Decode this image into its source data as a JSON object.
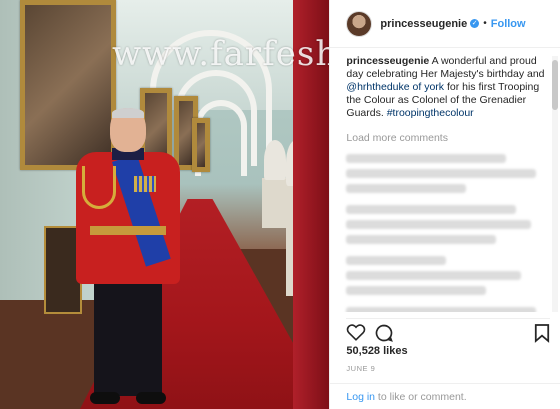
{
  "post_image": {
    "watermark": "www.farfesh.com"
  },
  "header": {
    "username": "princesseugenie",
    "separator": "•",
    "follow_label": "Follow"
  },
  "caption": {
    "username": "princesseugenie",
    "text_before_mention": " A wonderful and proud day celebrating Her Majesty's birthday and ",
    "mention": "@hrhtheduke of york",
    "text_after_mention": " for his first Trooping the Colour as Colonel of the Grenadier Guards. ",
    "hashtag": "#troopingthecolour"
  },
  "comments": {
    "load_more_label": "Load more comments"
  },
  "stats": {
    "likes": "50,528 likes",
    "date": "JUNE 9"
  },
  "login": {
    "link_label": "Log in",
    "suffix": " to like or comment."
  },
  "icons": {
    "like": "heart-icon",
    "comment": "comment-icon",
    "save": "bookmark-icon",
    "verified": "verified-badge-icon"
  },
  "colors": {
    "accent": "#3897f0",
    "link": "#003569",
    "muted": "#999999"
  }
}
